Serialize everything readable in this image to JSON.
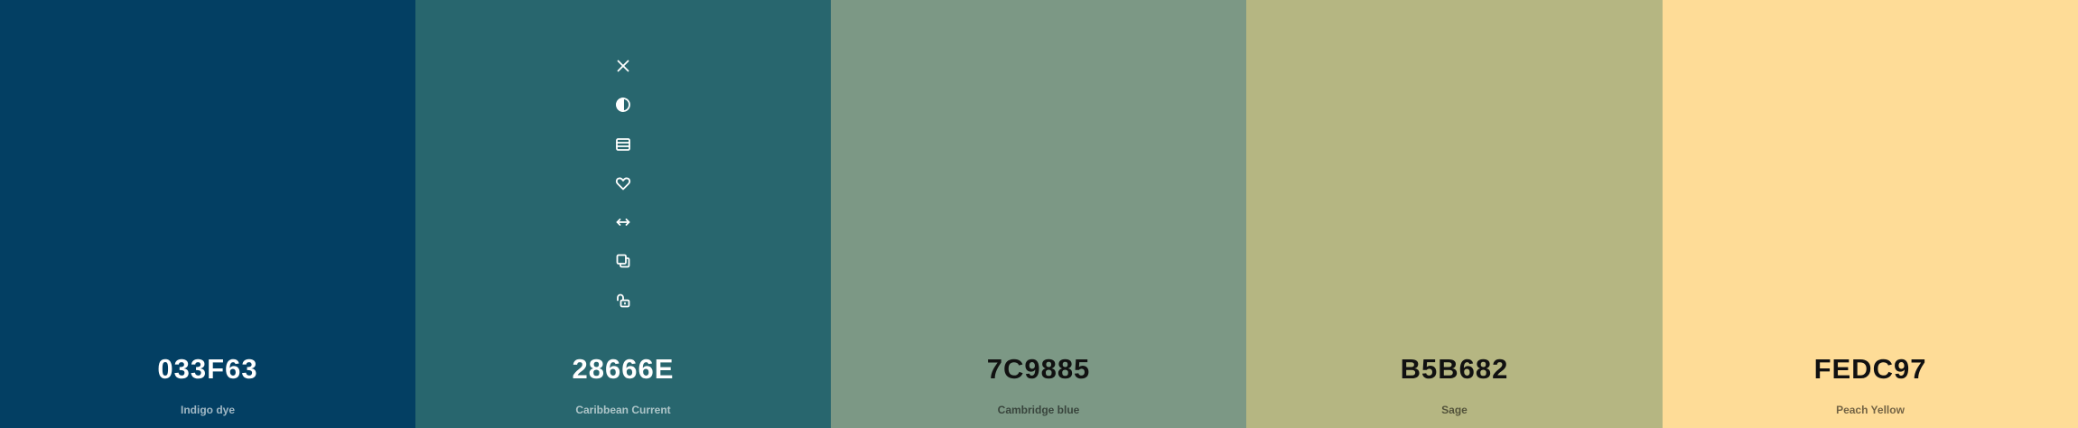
{
  "palette": [
    {
      "hex": "033F63",
      "name": "Indigo dye",
      "color": "#033F63",
      "tone": "dark"
    },
    {
      "hex": "28666E",
      "name": "Caribbean Current",
      "color": "#28666E",
      "tone": "dark"
    },
    {
      "hex": "7C9885",
      "name": "Cambridge blue",
      "color": "#7C9885",
      "tone": "light"
    },
    {
      "hex": "B5B682",
      "name": "Sage",
      "color": "#B5B682",
      "tone": "light"
    },
    {
      "hex": "FEDC97",
      "name": "Peach Yellow",
      "color": "#FEDC97",
      "tone": "light"
    }
  ],
  "toolbar": {
    "active_swatch": 1,
    "icons": [
      "close-icon",
      "contrast-icon",
      "shades-icon",
      "heart-icon",
      "drag-arrows-icon",
      "copy-icon",
      "unlock-icon"
    ]
  }
}
